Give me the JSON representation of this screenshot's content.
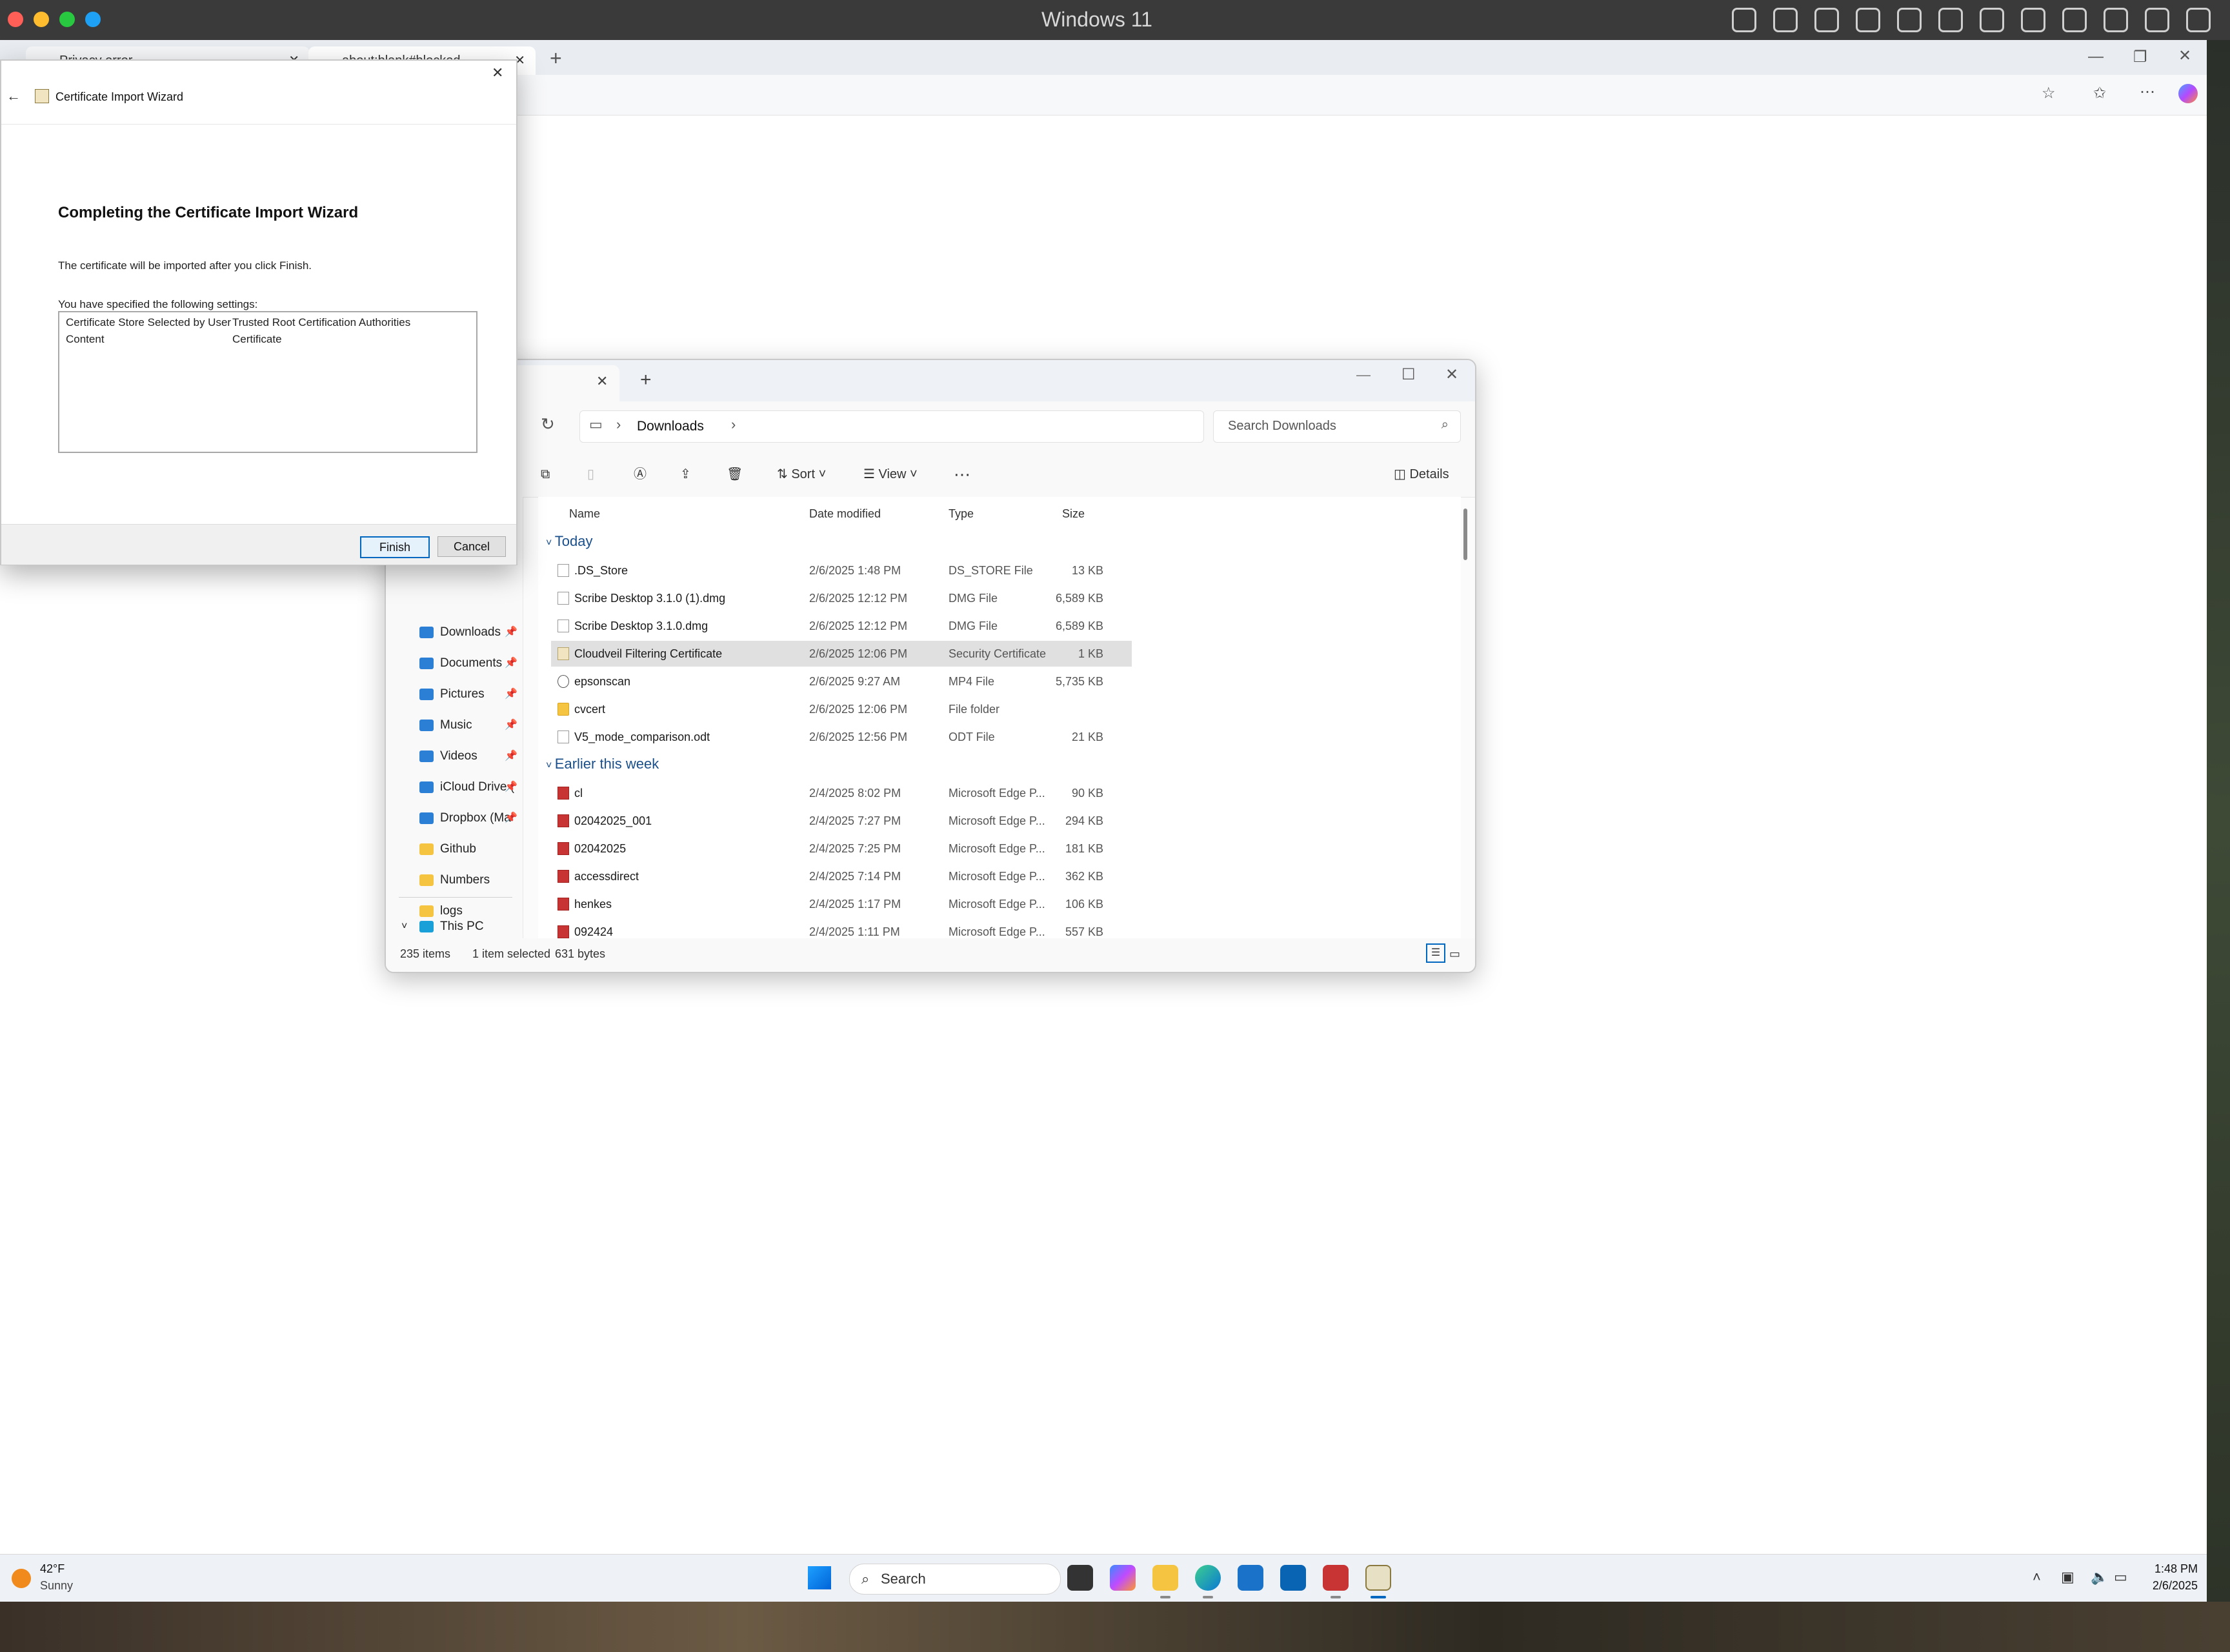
{
  "host": {
    "title": "Windows 11",
    "traffic_colors": [
      "#ff5f57",
      "#febc2e",
      "#28c840",
      "#1ea0f5"
    ]
  },
  "edge": {
    "tabs": [
      {
        "label": "Privacy error"
      },
      {
        "label": "about:blank#blocked"
      }
    ]
  },
  "wizard": {
    "title": "Certificate Import Wizard",
    "heading": "Completing the Certificate Import Wizard",
    "body": "The certificate will be imported after you click Finish.",
    "settings_label": "You have specified the following settings:",
    "settings": [
      {
        "key": "Certificate Store Selected by User",
        "value": "Trusted Root Certification Authorities"
      },
      {
        "key": "Content",
        "value": "Certificate"
      }
    ],
    "buttons": {
      "finish": "Finish",
      "cancel": "Cancel"
    }
  },
  "explorer": {
    "breadcrumb": "Downloads",
    "search_placeholder": "Search Downloads",
    "toolbar": {
      "sort": "Sort",
      "view": "View",
      "details": "Details"
    },
    "columns": {
      "name": "Name",
      "date": "Date modified",
      "type": "Type",
      "size": "Size"
    },
    "sidebar": [
      {
        "label": "Downloads",
        "pinned": true,
        "color": "#2b7fd4"
      },
      {
        "label": "Documents",
        "pinned": true,
        "color": "#2b7fd4"
      },
      {
        "label": "Pictures",
        "pinned": true,
        "color": "#2b7fd4"
      },
      {
        "label": "Music",
        "pinned": true,
        "color": "#2b7fd4"
      },
      {
        "label": "Videos",
        "pinned": true,
        "color": "#2b7fd4"
      },
      {
        "label": "iCloud Drive (",
        "pinned": true,
        "color": "#2b7fd4"
      },
      {
        "label": "Dropbox (Ma",
        "pinned": true,
        "color": "#2b7fd4"
      },
      {
        "label": "Github",
        "pinned": false,
        "color": "#f5c542"
      },
      {
        "label": "Numbers",
        "pinned": false,
        "color": "#f5c542"
      },
      {
        "label": "logs",
        "pinned": false,
        "color": "#f5c542"
      }
    ],
    "this_pc": "This PC",
    "groups": [
      {
        "label": "Today",
        "files": [
          {
            "name": ".DS_Store",
            "date": "2/6/2025 1:48 PM",
            "type": "DS_STORE File",
            "size": "13 KB",
            "icon": "file"
          },
          {
            "name": "Scribe Desktop 3.1.0 (1).dmg",
            "date": "2/6/2025 12:12 PM",
            "type": "DMG File",
            "size": "6,589 KB",
            "icon": "file"
          },
          {
            "name": "Scribe Desktop 3.1.0.dmg",
            "date": "2/6/2025 12:12 PM",
            "type": "DMG File",
            "size": "6,589 KB",
            "icon": "file"
          },
          {
            "name": "Cloudveil Filtering Certificate",
            "date": "2/6/2025 12:06 PM",
            "type": "Security Certificate",
            "size": "1 KB",
            "icon": "cert",
            "selected": true
          },
          {
            "name": "epsonscan",
            "date": "2/6/2025 9:27 AM",
            "type": "MP4 File",
            "size": "5,735 KB",
            "icon": "mp4"
          },
          {
            "name": "cvcert",
            "date": "2/6/2025 12:06 PM",
            "type": "File folder",
            "size": "",
            "icon": "folder"
          },
          {
            "name": "V5_mode_comparison.odt",
            "date": "2/6/2025 12:56 PM",
            "type": "ODT File",
            "size": "21 KB",
            "icon": "file"
          }
        ]
      },
      {
        "label": "Earlier this week",
        "files": [
          {
            "name": "cl",
            "date": "2/4/2025 8:02 PM",
            "type": "Microsoft Edge P...",
            "size": "90 KB",
            "icon": "pdf"
          },
          {
            "name": "02042025_001",
            "date": "2/4/2025 7:27 PM",
            "type": "Microsoft Edge P...",
            "size": "294 KB",
            "icon": "pdf"
          },
          {
            "name": "02042025",
            "date": "2/4/2025 7:25 PM",
            "type": "Microsoft Edge P...",
            "size": "181 KB",
            "icon": "pdf"
          },
          {
            "name": "accessdirect",
            "date": "2/4/2025 7:14 PM",
            "type": "Microsoft Edge P...",
            "size": "362 KB",
            "icon": "pdf"
          },
          {
            "name": "henkes",
            "date": "2/4/2025 1:17 PM",
            "type": "Microsoft Edge P...",
            "size": "106 KB",
            "icon": "pdf"
          },
          {
            "name": "092424",
            "date": "2/4/2025 1:11 PM",
            "type": "Microsoft Edge P...",
            "size": "557 KB",
            "icon": "pdf"
          }
        ]
      }
    ],
    "status": {
      "items": "235 items",
      "selected": "1 item selected",
      "bytes": "631 bytes"
    }
  },
  "taskbar": {
    "weather_temp": "42°F",
    "weather_desc": "Sunny",
    "search": "Search",
    "time": "1:48 PM",
    "date": "2/6/2025"
  }
}
